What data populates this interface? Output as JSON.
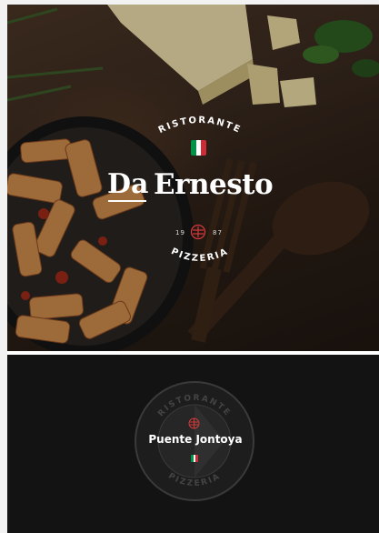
{
  "hero": {
    "ristorante": "RISTORANTE",
    "brand_da": "Da",
    "brand_name": "Ernesto",
    "year_left": "19",
    "year_right": "87",
    "pizzeria": "PIZZERIA"
  },
  "footer": {
    "location_label": "Puente Jontoya",
    "badge_top": "RISTORANTE",
    "badge_bottom": "PIZZERIA"
  },
  "icons": {
    "flag": "italian-flag-icon",
    "emblem": "restaurant-emblem-icon"
  },
  "colors": {
    "flag_green": "#009246",
    "flag_white": "#ffffff",
    "flag_red": "#ce2b37",
    "emblem_red": "#d43a3a",
    "dark_bg": "#131313"
  }
}
